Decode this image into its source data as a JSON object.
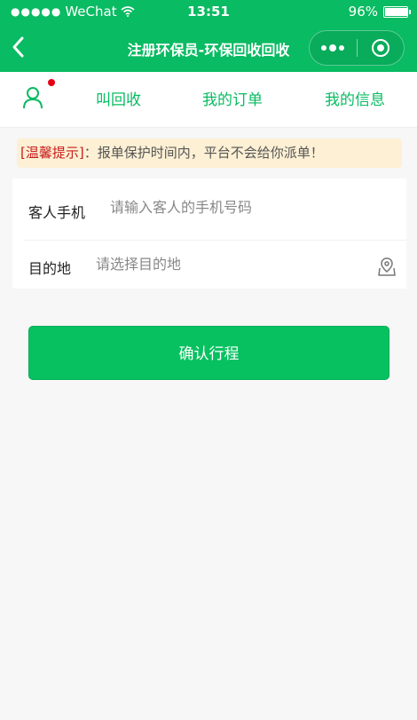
{
  "status_bar": {
    "carrier": "WeChat",
    "time": "13:51",
    "battery": "96%",
    "battery_level": 0.96
  },
  "nav": {
    "title": "注册环保员-环保回收回收",
    "back_icon": "chevron-left-icon",
    "more_icon": "more-dots-icon",
    "close_icon": "target-close-icon"
  },
  "tabs": [
    {
      "label": "叫回收"
    },
    {
      "label": "我的订单"
    },
    {
      "label": "我的信息"
    }
  ],
  "user_icon": "user-icon",
  "notice": {
    "tag": "[温馨提示]",
    "text": "：报单保护时间内，平台不会给你派单！"
  },
  "form": {
    "phone_label": "客人手机",
    "phone_placeholder": "请输入客人的手机号码",
    "phone_value": "",
    "dest_label": "目的地",
    "dest_placeholder": "请选择目的地",
    "dest_value": "",
    "location_icon": "map-pin-icon"
  },
  "confirm_label": "确认行程",
  "colors": {
    "brand": "#09bb62",
    "button": "#07c160",
    "notice_bg": "#fdf0d4",
    "notice_tag": "#c81c1c",
    "badge": "#e60012"
  }
}
